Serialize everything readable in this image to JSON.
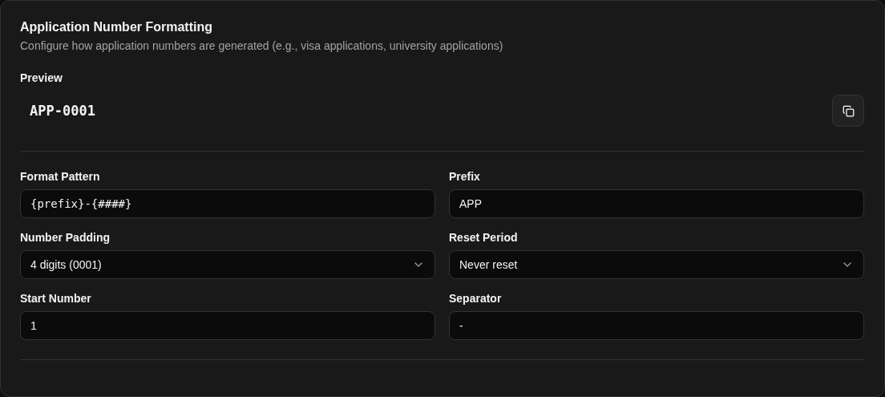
{
  "title": "Application Number Formatting",
  "description": "Configure how application numbers are generated (e.g., visa applications, university applications)",
  "preview": {
    "label": "Preview",
    "value": "APP-0001"
  },
  "fields": [
    {
      "label": "Format Pattern",
      "kind": "mono",
      "value": "{prefix}-{####}"
    },
    {
      "label": "Prefix",
      "kind": "text",
      "value": "APP"
    },
    {
      "label": "Number Padding",
      "kind": "select",
      "value": "4 digits (0001)"
    },
    {
      "label": "Reset Period",
      "kind": "select",
      "value": "Never reset"
    },
    {
      "label": "Start Number",
      "kind": "text",
      "value": "1"
    },
    {
      "label": "Separator",
      "kind": "text",
      "value": "-"
    }
  ]
}
